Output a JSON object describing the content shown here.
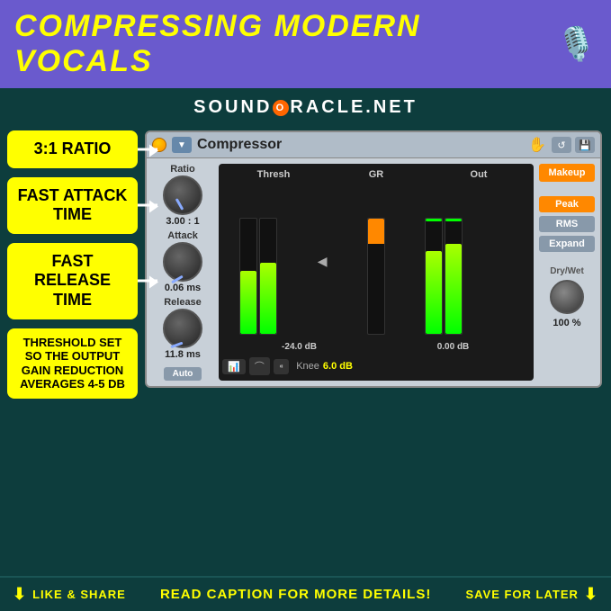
{
  "header": {
    "title": "COMPRESSING MODERN VOCALS",
    "mic_icon": "🎙️"
  },
  "subtitle": {
    "text_before": "SOUND",
    "o_letter": "O",
    "text_after": "RACLE.NET"
  },
  "labels": [
    {
      "id": "ratio",
      "text": "3:1 RATIO"
    },
    {
      "id": "attack",
      "text": "FAST ATTACK TIME"
    },
    {
      "id": "release",
      "text": "FAST RELEASE TIME"
    },
    {
      "id": "threshold",
      "text": "THRESHOLD SET SO THE OUTPUT GAIN REDUCTION AVERAGES 4-5 DB",
      "small": true
    }
  ],
  "compressor": {
    "title": "Compressor",
    "hand_icon": "✋",
    "ratio_label": "Ratio",
    "ratio_value": "3.00 : 1",
    "attack_label": "Attack",
    "attack_value": "0.06 ms",
    "release_label": "Release",
    "release_value": "11.8 ms",
    "auto_btn": "Auto",
    "thresh_label": "Thresh",
    "gr_label": "GR",
    "out_label": "Out",
    "thresh_db": "-24.0 dB",
    "out_db": "0.00 dB",
    "knee_label": "Knee",
    "knee_value": "6.0 dB",
    "makeup_label": "Makeup",
    "peak_label": "Peak",
    "rms_label": "RMS",
    "expand_label": "Expand",
    "dry_wet_label": "Dry/Wet",
    "dry_wet_value": "100 %"
  },
  "footer": {
    "left_icon": "⬇",
    "left_text": "LIKE & SHARE",
    "center_text": "READ CAPTION FOR MORE DETAILS!",
    "right_text": "SAVE FOR LATER",
    "right_icon": "⬇"
  }
}
